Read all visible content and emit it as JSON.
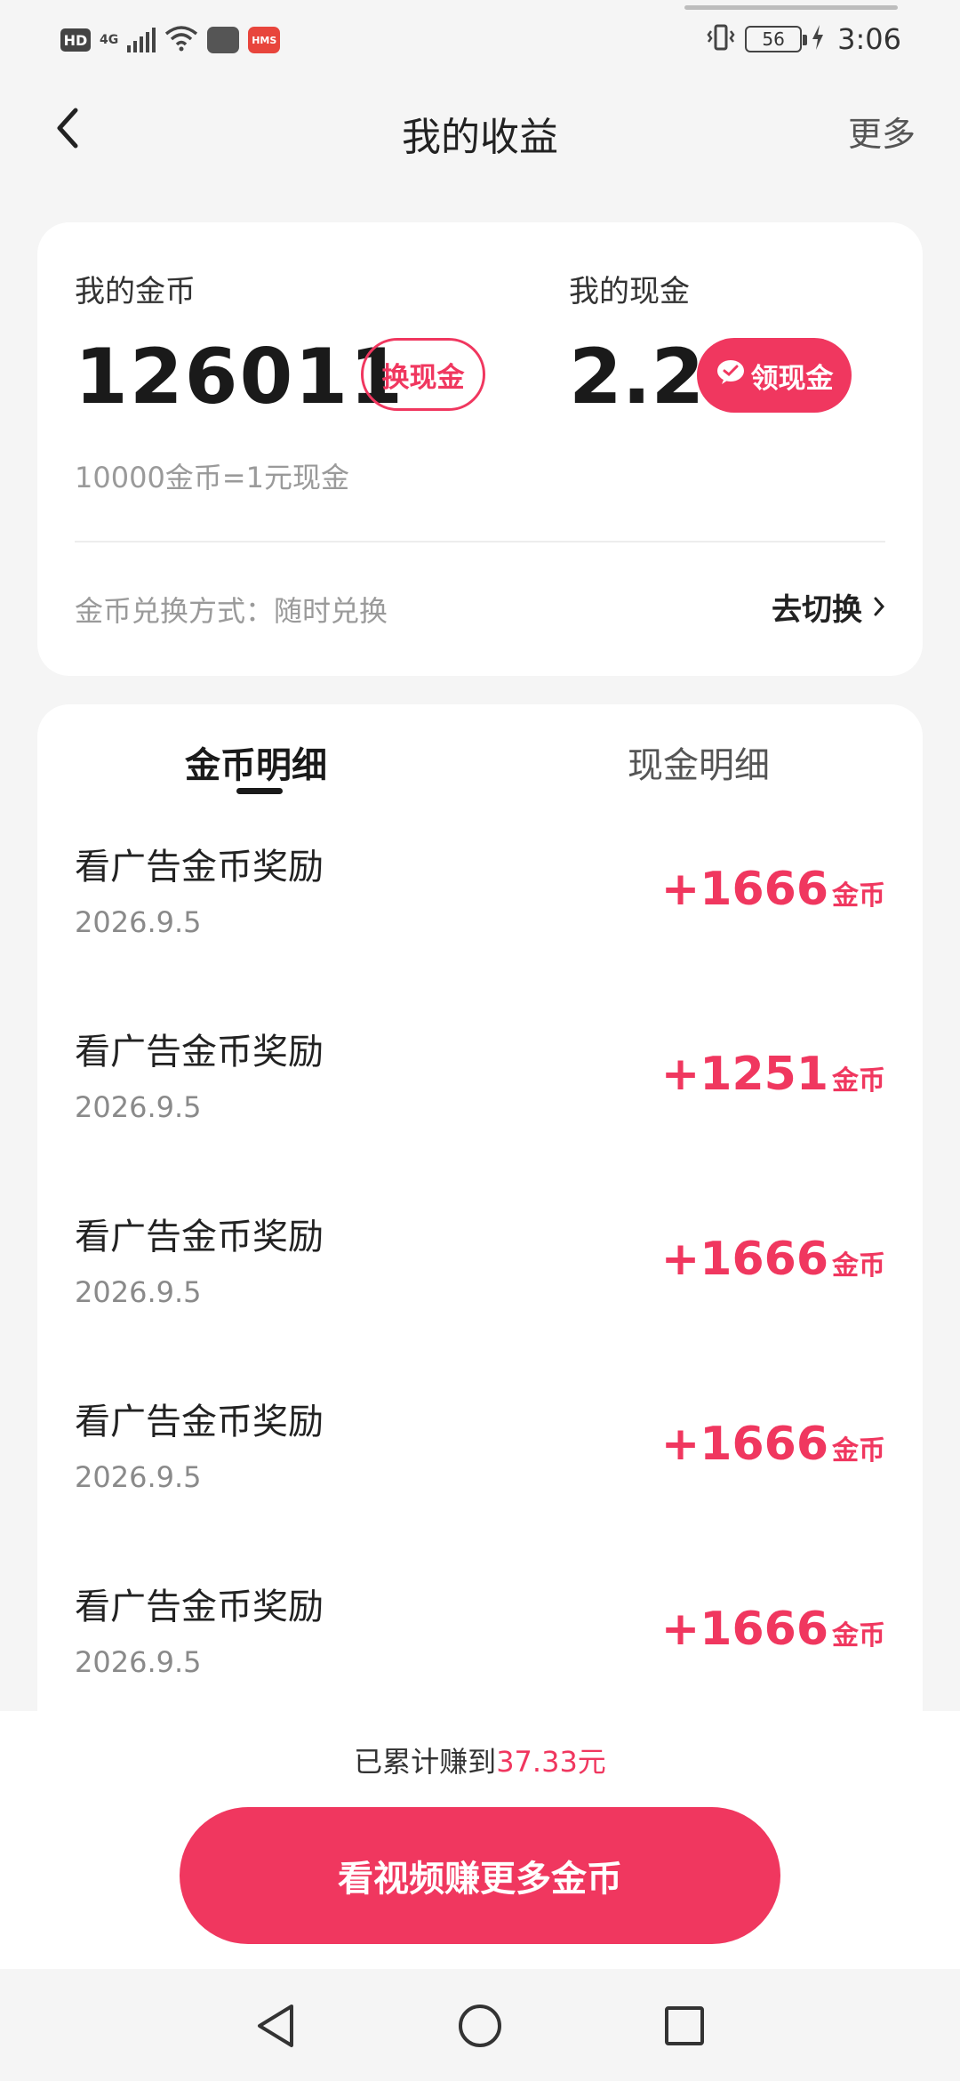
{
  "status_bar": {
    "hd": "HD",
    "network": "4G",
    "hms": "HMS",
    "battery": "56",
    "time": "3:06"
  },
  "header": {
    "title": "我的收益",
    "more": "更多"
  },
  "earnings": {
    "coins_label": "我的金币",
    "coins_value": "126011",
    "exchange_button": "换现金",
    "cash_label": "我的现金",
    "cash_value": "2.2",
    "withdraw_button": "领现金",
    "rate": "10000金币=1元现金",
    "method": "金币兑换方式：随时兑换",
    "switch_link": "去切换"
  },
  "tabs": [
    {
      "label": "金币明细",
      "active": true
    },
    {
      "label": "现金明细",
      "active": false
    }
  ],
  "records": [
    {
      "title": "看广告金币奖励",
      "date": "2026.9.5",
      "amount": "+1666",
      "unit": "金币"
    },
    {
      "title": "看广告金币奖励",
      "date": "2026.9.5",
      "amount": "+1251",
      "unit": "金币"
    },
    {
      "title": "看广告金币奖励",
      "date": "2026.9.5",
      "amount": "+1666",
      "unit": "金币"
    },
    {
      "title": "看广告金币奖励",
      "date": "2026.9.5",
      "amount": "+1666",
      "unit": "金币"
    },
    {
      "title": "看广告金币奖励",
      "date": "2026.9.5",
      "amount": "+1666",
      "unit": "金币"
    }
  ],
  "footer": {
    "cumulative_prefix": "已累计赚到",
    "cumulative_amount": "37.33元",
    "cta": "看视频赚更多金币"
  },
  "colors": {
    "accent": "#f0375f",
    "background": "#f5f5f5",
    "card": "#ffffff"
  }
}
